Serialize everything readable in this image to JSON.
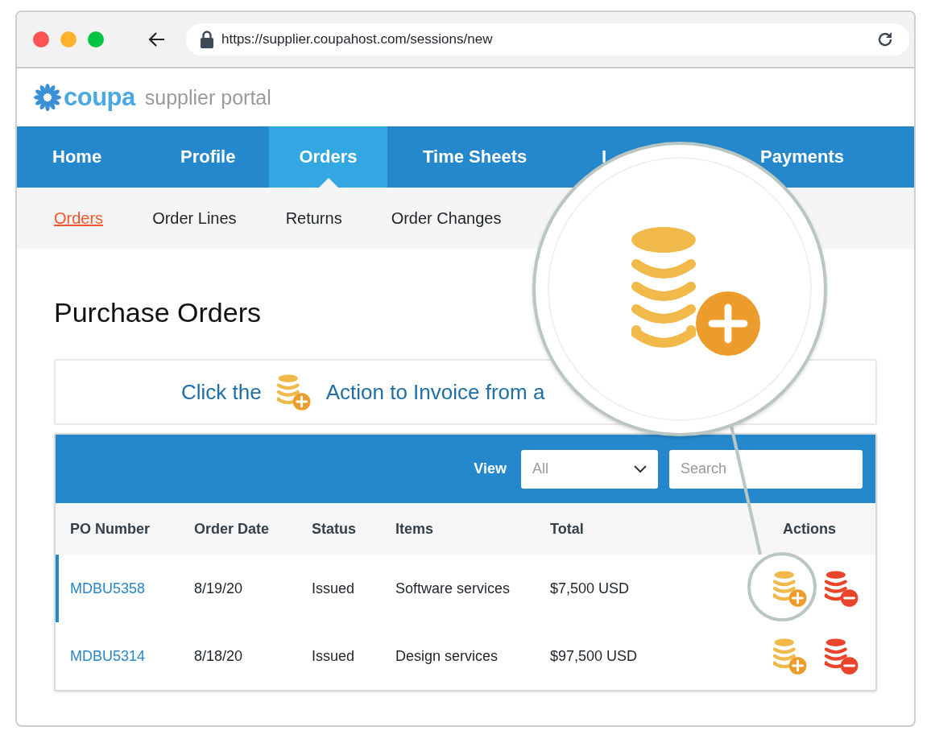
{
  "browser": {
    "url": "https://supplier.coupahost.com/sessions/new"
  },
  "header": {
    "brand": "coupa",
    "subtitle": "supplier portal"
  },
  "nav": [
    {
      "label": "Home",
      "selected": false
    },
    {
      "label": "Profile",
      "selected": false
    },
    {
      "label": "Orders",
      "selected": true
    },
    {
      "label": "Time Sheets",
      "selected": false
    },
    {
      "label": "I",
      "selected": false
    },
    {
      "label": "Payments",
      "selected": false
    }
  ],
  "subnav": [
    {
      "label": "Orders",
      "selected": true
    },
    {
      "label": "Order Lines",
      "selected": false
    },
    {
      "label": "Returns",
      "selected": false
    },
    {
      "label": "Order Changes",
      "selected": false
    }
  ],
  "page_title": "Purchase Orders",
  "banner": {
    "before": "Click the",
    "after": "Action to Invoice from a"
  },
  "toolbar": {
    "view_label": "View",
    "view_value": "All",
    "search_placeholder": "Search"
  },
  "table": {
    "columns": [
      "PO Number",
      "Order Date",
      "Status",
      "Items",
      "Total",
      "Actions"
    ],
    "rows": [
      {
        "po": "MDBU5358",
        "date": "8/19/20",
        "status": "Issued",
        "items": "Software services",
        "total": "$7,500 USD",
        "selected": true
      },
      {
        "po": "MDBU5314",
        "date": "8/18/20",
        "status": "Issued",
        "items": "Design services",
        "total": "$97,500 USD",
        "selected": false
      }
    ]
  }
}
